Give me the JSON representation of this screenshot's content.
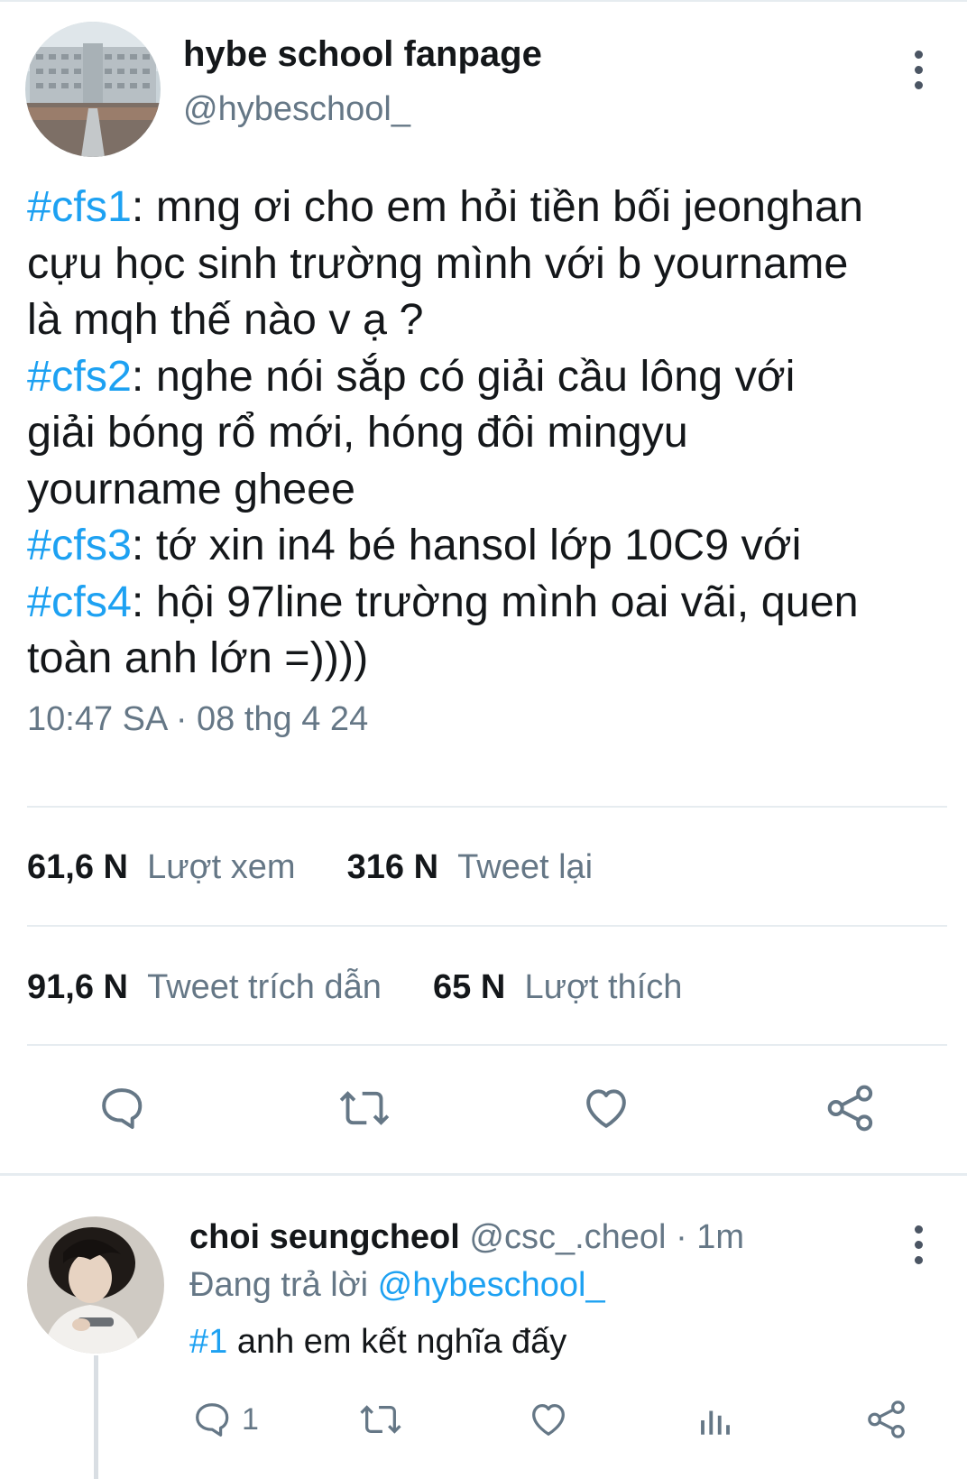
{
  "tweet": {
    "author_name": "hybe school fanpage",
    "author_handle": "@hybeschool_",
    "lines": [
      {
        "tag": "#cfs1",
        "text": ": mng ơi cho em hỏi tiền bối jeonghan"
      },
      {
        "tag": "",
        "text": "cựu học sinh trường mình với b yourname"
      },
      {
        "tag": "",
        "text": "là mqh thế nào v ạ ?"
      },
      {
        "tag": "#cfs2",
        "text": ": nghe nói sắp có giải cầu lông với"
      },
      {
        "tag": "",
        "text": "giải bóng rổ mới, hóng đôi mingyu"
      },
      {
        "tag": "",
        "text": "yourname gheee"
      },
      {
        "tag": "#cfs3",
        "text": ": tớ xin in4 bé hansol lớp 10C9 với"
      },
      {
        "tag": "#cfs4",
        "text": ": hội 97line trường mình oai vãi, quen"
      },
      {
        "tag": "",
        "text": "toàn anh lớn =))))"
      }
    ],
    "time": "10:47 SA",
    "separator": "·",
    "date": "08 thg 4 24",
    "stats": {
      "views_count": "61,6 N",
      "views_label": "Lượt xem",
      "retweets_count": "316 N",
      "retweets_label": "Tweet lại",
      "quotes_count": "91,6 N",
      "quotes_label": "Tweet trích dẫn",
      "likes_count": "65 N",
      "likes_label": "Lượt thích"
    },
    "actions": [
      "reply-icon",
      "retweet-icon",
      "like-icon",
      "share-icon"
    ]
  },
  "reply": {
    "author_name": "choi seungcheol",
    "author_handle": "@csc_.cheol",
    "separator": "·",
    "time": "1m",
    "replying_label": "Đang trả lời",
    "replying_to": "@hybeschool_",
    "tag": "#1",
    "text": " anh em kết nghĩa đấy",
    "reply_count": "1",
    "actions": [
      "reply-icon",
      "retweet-icon",
      "like-icon",
      "analytics-icon",
      "share-icon"
    ]
  },
  "colors": {
    "accent": "#1da1f2",
    "secondary_text": "#657786",
    "primary_text": "#14171a",
    "divider": "#e6ecf0"
  }
}
